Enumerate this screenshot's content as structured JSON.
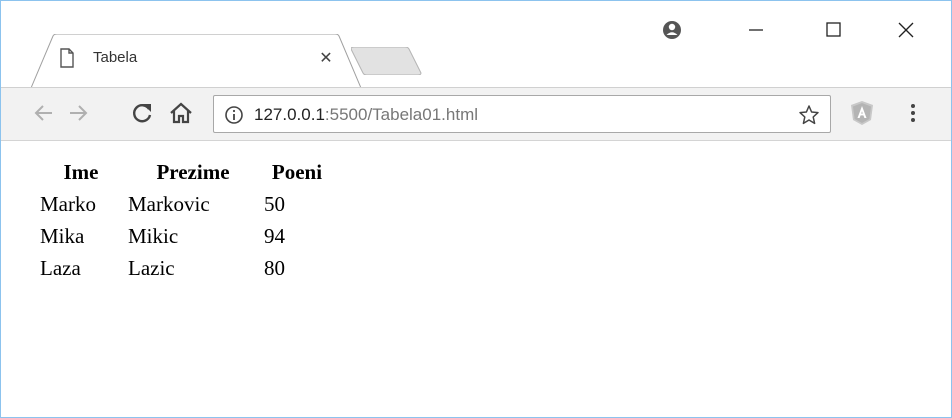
{
  "tab": {
    "title": "Tabela",
    "close_glyph": "✕"
  },
  "toolbar": {
    "url_host": "127.0.0.1",
    "url_rest": ":5500/Tabela01.html"
  },
  "table": {
    "headers": [
      "Ime",
      "Prezime",
      "Poeni"
    ],
    "rows": [
      [
        "Marko",
        "Markovic",
        "50"
      ],
      [
        "Mika",
        "Mikic",
        "94"
      ],
      [
        "Laza",
        "Lazic",
        "80"
      ]
    ]
  },
  "icons": {
    "tab_icon": "page-icon",
    "profile": "profile-icon",
    "minimize": "minimize-icon",
    "maximize": "maximize-icon",
    "close": "close-icon",
    "back": "back-arrow-icon",
    "forward": "forward-arrow-icon",
    "reload": "reload-icon",
    "home": "home-icon",
    "info": "info-icon",
    "bookmark": "star-icon",
    "extension": "angular-extension-icon",
    "menu": "more-vertical-icon"
  },
  "colors": {
    "window_border": "#8cc3ee",
    "toolbar_bg": "#f2f2f2",
    "url_host": "#222222",
    "url_rest": "#777777"
  }
}
